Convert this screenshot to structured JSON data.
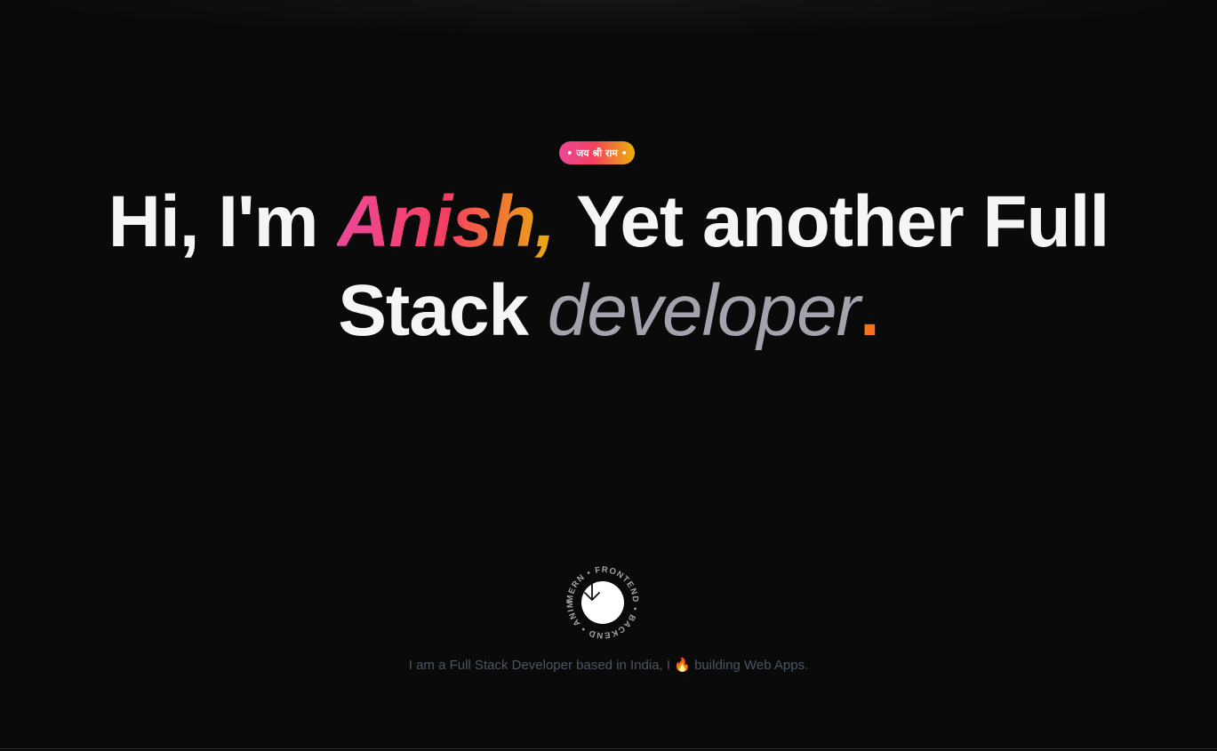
{
  "badge": {
    "text": "• जय श्री राम •"
  },
  "hero": {
    "line1_prefix": "Hi, I'm ",
    "name": "Anish,",
    "line1_suffix": " Yet another Full",
    "line2_prefix": "Stack ",
    "line2_italic": "developer",
    "line2_dot": "."
  },
  "scroll_badge": {
    "circular_text": "MERN • FRONTEND • BACKEND • ANIME • ",
    "icon": "arrow-down-icon"
  },
  "tagline": {
    "before": "I am a Full Stack Developer based in India, I ",
    "emoji": "🔥",
    "after": " building Web Apps."
  },
  "colors": {
    "background": "#0a0a0a",
    "accent_orange": "#f97316",
    "gradient_start": "#ec4899",
    "gradient_end": "#eab308"
  }
}
